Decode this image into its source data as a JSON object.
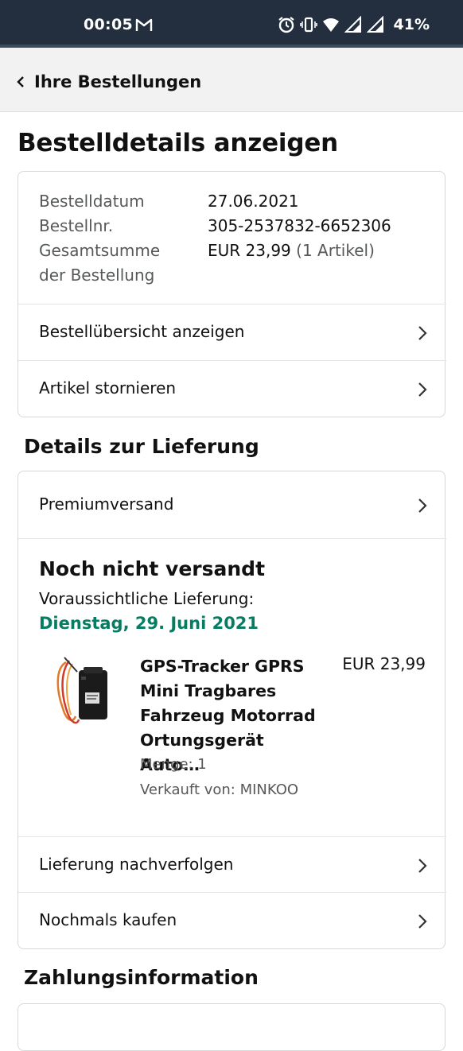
{
  "status_bar": {
    "time": "00:05",
    "battery": "41%",
    "icons": [
      "gmail-icon",
      "alarm-icon",
      "vibrate-icon",
      "wifi-icon",
      "signal-icon",
      "signal-icon-2"
    ]
  },
  "nav": {
    "back_label": "Ihre Bestellungen"
  },
  "page_title": "Bestelldetails anzeigen",
  "summary": {
    "order_date_label": "Bestelldatum",
    "order_date_value": "27.06.2021",
    "order_no_label": "Bestellnr.",
    "order_no_value": "305-2537832-6652306",
    "total_label_line1": "Gesamtsumme",
    "total_label_line2": "der Bestellung",
    "total_value": "EUR 23,99",
    "total_items": "(1 Artikel)"
  },
  "order_actions": [
    {
      "label": "Bestellübersicht anzeigen"
    },
    {
      "label": "Artikel stornieren"
    }
  ],
  "delivery": {
    "section_title": "Details zur Lieferung",
    "shipping_method": "Premiumversand",
    "status": "Noch nicht versandt",
    "expected_label": "Voraussichtliche Lieferung:",
    "expected_date": "Dienstag, 29. Juni 2021",
    "product": {
      "title": "GPS-Tracker GPRS Mini Tragbares Fahrzeug Motorrad Ortungsgerät Auto…",
      "price": "EUR 23,99",
      "quantity": "Menge: 1",
      "seller": "Verkauft von: MINKOO"
    },
    "actions": [
      {
        "label": "Lieferung nachverfolgen"
      },
      {
        "label": "Nochmals kaufen"
      }
    ]
  },
  "payment": {
    "section_title": "Zahlungsinformation"
  },
  "colors": {
    "status_bar": "#232f3e",
    "delivery_date": "#067d62",
    "muted_text": "#565959"
  }
}
